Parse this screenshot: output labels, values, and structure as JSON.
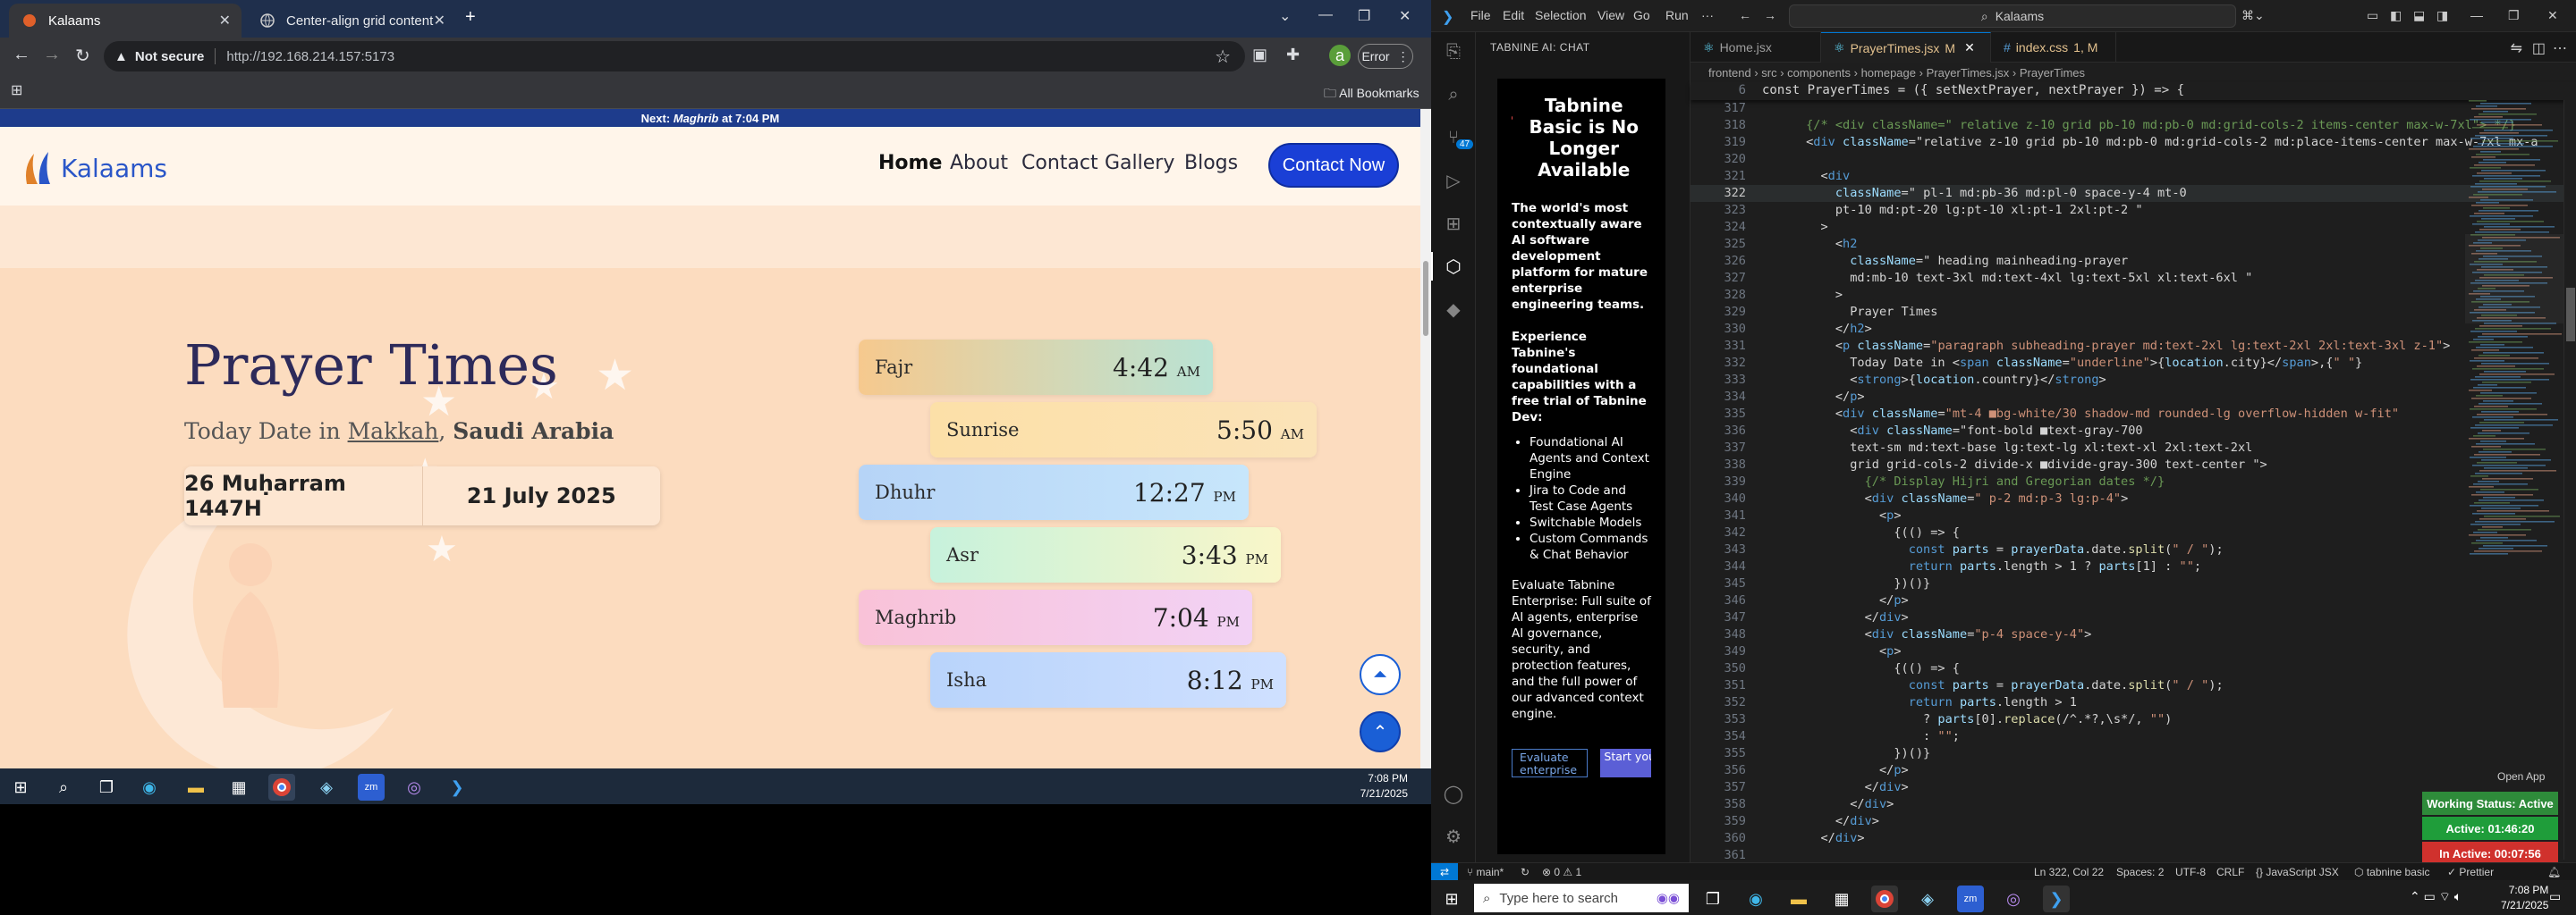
{
  "browser": {
    "tabs": [
      {
        "title": "Kalaams",
        "active": true
      },
      {
        "title": "Center-align grid content",
        "active": false
      }
    ],
    "url": {
      "security": "Not secure",
      "address": "http://192.168.214.157:5173"
    },
    "error_label": "Error",
    "bookmarks_label": "All Bookmarks",
    "window_time": "7:08 PM",
    "window_date": "7/21/2025"
  },
  "site": {
    "announcement_prefix": "Next:",
    "announcement_prayer": "Maghrib",
    "announcement_suffix": "at 7:04 PM",
    "logo": "Kalaams",
    "nav": [
      "Home",
      "About",
      "Contact",
      "Gallery",
      "Blogs"
    ],
    "contact_button": "Contact Now",
    "title": "Prayer Times",
    "subtitle_prefix": "Today Date in",
    "city": "Makkah",
    "country": "Saudi Arabia",
    "hijri_date": "26 Muḥarram 1447H",
    "gregorian_date": "21 July 2025",
    "prayers": [
      {
        "name": "Fajr",
        "time": "4:42",
        "ampm": "AM",
        "color": "#f6c98e"
      },
      {
        "name": "Sunrise",
        "time": "5:50",
        "ampm": "AM",
        "color": "#fce0a8"
      },
      {
        "name": "Dhuhr",
        "time": "12:27",
        "ampm": "PM",
        "color": "#b6d4f7"
      },
      {
        "name": "Asr",
        "time": "3:43",
        "ampm": "PM",
        "color": "#c7f2dc"
      },
      {
        "name": "Maghrib",
        "time": "7:04",
        "ampm": "PM",
        "color": "#f9c2d8"
      },
      {
        "name": "Isha",
        "time": "8:12",
        "ampm": "PM",
        "color": "#b9d4fb"
      }
    ]
  },
  "vscode": {
    "menu": [
      "File",
      "Edit",
      "Selection",
      "View",
      "Go",
      "Run",
      "···"
    ],
    "search": "Kalaams",
    "chat_header": "TABNINE AI: CHAT",
    "chat": {
      "heading": "Tabnine Basic is No Longer Available",
      "para1": "The world's most contextually aware AI software development platform for mature enterprise engineering teams.",
      "para2": "Experience Tabnine's foundational capabilities with a free trial of Tabnine Dev:",
      "bullets": [
        "Foundational AI Agents and Context Engine",
        "Jira to Code and Test Case Agents",
        "Switchable Models",
        "Custom Commands & Chat Behavior"
      ],
      "para3": "Evaluate Tabnine Enterprise: Full suite of AI agents, enterprise AI governance, security, and protection features, and the full power of our advanced context engine.",
      "btn_evaluate": "Evaluate enterprise",
      "btn_trial": "Start your Dev trial"
    },
    "editor_tabs": [
      {
        "name": "Home.jsx",
        "active": false,
        "mark": ""
      },
      {
        "name": "PrayerTimes.jsx",
        "active": true,
        "mark": "M"
      },
      {
        "name": "index.css",
        "active": false,
        "mark": "1, M"
      }
    ],
    "breadcrumb": [
      "frontend",
      "src",
      "components",
      "homepage",
      "PrayerTimes.jsx",
      "PrayerTimes"
    ],
    "sticky_line": {
      "num": "6",
      "text": "const PrayerTimes = ({ setNextPrayer, nextPrayer }) => {"
    },
    "code_lines": [
      {
        "n": "317",
        "t": ""
      },
      {
        "n": "318",
        "t": "      {/* <div className=\" relative z-10 grid pb-10 md:pb-0 md:grid-cols-2 items-center max-w-7xl\"> */}"
      },
      {
        "n": "319",
        "t": "      <div className=\"relative z-10 grid pb-10 md:pb-0 md:grid-cols-2 md:place-items-center max-w-7xl mx-a"
      },
      {
        "n": "320",
        "t": ""
      },
      {
        "n": "321",
        "t": "        <div"
      },
      {
        "n": "322",
        "t": "          className=\" pl-1 md:pb-36 md:pl-0 space-y-4 mt-0"
      },
      {
        "n": "323",
        "t": "          pt-10 md:pt-20 lg:pt-10 xl:pt-1 2xl:pt-2 \""
      },
      {
        "n": "324",
        "t": "        >"
      },
      {
        "n": "325",
        "t": "          <h2"
      },
      {
        "n": "326",
        "t": "            className=\" heading mainheading-prayer"
      },
      {
        "n": "327",
        "t": "            md:mb-10 text-3xl md:text-4xl lg:text-5xl xl:text-6xl \""
      },
      {
        "n": "328",
        "t": "          >"
      },
      {
        "n": "329",
        "t": "            Prayer Times"
      },
      {
        "n": "330",
        "t": "          </h2>"
      },
      {
        "n": "331",
        "t": "          <p className=\"paragraph subheading-prayer md:text-2xl lg:text-2xl 2xl:text-3xl z-1\">"
      },
      {
        "n": "332",
        "t": "            Today Date in <span className=\"underline\">{location.city}</span>,{\" \"}"
      },
      {
        "n": "333",
        "t": "            <strong>{location.country}</strong>"
      },
      {
        "n": "334",
        "t": "          </p>"
      },
      {
        "n": "335",
        "t": "          <div className=\"mt-4 ■bg-white/30 shadow-md rounded-lg overflow-hidden w-fit\""
      },
      {
        "n": "336",
        "t": "            <div className=\"font-bold ■text-gray-700"
      },
      {
        "n": "337",
        "t": "            text-sm md:text-base lg:text-lg xl:text-xl 2xl:text-2xl"
      },
      {
        "n": "338",
        "t": "            grid grid-cols-2 divide-x ■divide-gray-300 text-center \">"
      },
      {
        "n": "339",
        "t": "              {/* Display Hijri and Gregorian dates */}"
      },
      {
        "n": "340",
        "t": "              <div className=\" p-2 md:p-3 lg:p-4\">"
      },
      {
        "n": "341",
        "t": "                <p>"
      },
      {
        "n": "342",
        "t": "                  {(() => {"
      },
      {
        "n": "343",
        "t": "                    const parts = prayerData.date.split(\" / \");"
      },
      {
        "n": "344",
        "t": "                    return parts.length > 1 ? parts[1] : \"\";"
      },
      {
        "n": "345",
        "t": "                  })()}"
      },
      {
        "n": "346",
        "t": "                </p>"
      },
      {
        "n": "347",
        "t": "              </div>"
      },
      {
        "n": "348",
        "t": "              <div className=\"p-4 space-y-4\">"
      },
      {
        "n": "349",
        "t": "                <p>"
      },
      {
        "n": "350",
        "t": "                  {(() => {"
      },
      {
        "n": "351",
        "t": "                    const parts = prayerData.date.split(\" / \");"
      },
      {
        "n": "352",
        "t": "                    return parts.length > 1"
      },
      {
        "n": "353",
        "t": "                      ? parts[0].replace(/^.*?,\\s*/, \"\")"
      },
      {
        "n": "354",
        "t": "                      : \"\";"
      },
      {
        "n": "355",
        "t": "                  })()}"
      },
      {
        "n": "356",
        "t": "                </p>"
      },
      {
        "n": "357",
        "t": "              </div>"
      },
      {
        "n": "358",
        "t": "            </div>"
      },
      {
        "n": "359",
        "t": "          </div>"
      },
      {
        "n": "360",
        "t": "        </div>"
      },
      {
        "n": "361",
        "t": ""
      }
    ],
    "status": {
      "branch": "main*",
      "problems": "⊗ 0 ⚠ 1",
      "position": "Ln 322, Col 22",
      "spaces": "Spaces: 2",
      "encoding": "UTF-8",
      "eol": "CRLF",
      "language": "JavaScript JSX",
      "tabnine": "tabnine basic",
      "prettier": "Prettier"
    },
    "open_app": "Open App",
    "working_status": "Working Status: Active",
    "active_time": "Active: 01:46:20",
    "inactive_time": "In Active: 00:07:56",
    "badge": "47"
  },
  "taskbar": {
    "search_placeholder": "Type here to search",
    "time": "7:08 PM",
    "date": "7/21/2025"
  }
}
